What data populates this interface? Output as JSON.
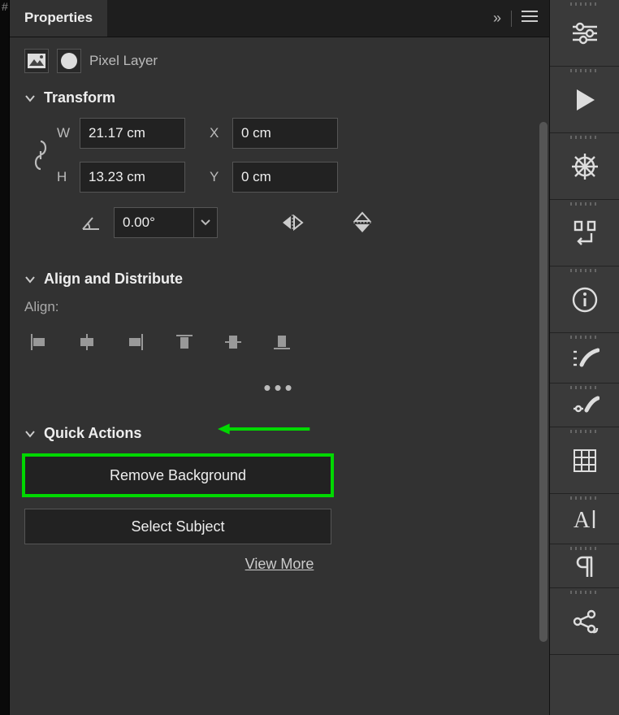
{
  "panel": {
    "tab_title": "Properties",
    "layer_type_label": "Pixel Layer"
  },
  "sections": {
    "transform": {
      "title": "Transform",
      "w_label": "W",
      "w_value": "21.17 cm",
      "h_label": "H",
      "h_value": "13.23 cm",
      "x_label": "X",
      "x_value": "0 cm",
      "y_label": "Y",
      "y_value": "0 cm",
      "rotation_value": "0.00°"
    },
    "align": {
      "title": "Align and Distribute",
      "label": "Align:"
    },
    "quick_actions": {
      "title": "Quick Actions",
      "remove_bg_label": "Remove Background",
      "select_subject_label": "Select Subject",
      "view_more_label": "View More"
    }
  },
  "icons": {
    "collapse": "chevrons-right",
    "menu": "menu",
    "link": "chain-link",
    "angle": "angle",
    "flip_h": "flip-horizontal",
    "flip_v": "flip-vertical",
    "align_left": "align-left",
    "align_hcenter": "align-h-center",
    "align_right": "align-right",
    "align_top": "align-top",
    "align_vcenter": "align-v-center",
    "align_bottom": "align-bottom",
    "more": "more-dots"
  },
  "right_tools": [
    "adjustments",
    "play",
    "wheel",
    "swap-panels",
    "info",
    "brush-list",
    "brush-settings",
    "grid",
    "character",
    "paragraph",
    "share"
  ],
  "annotation": {
    "color": "#00d800"
  }
}
